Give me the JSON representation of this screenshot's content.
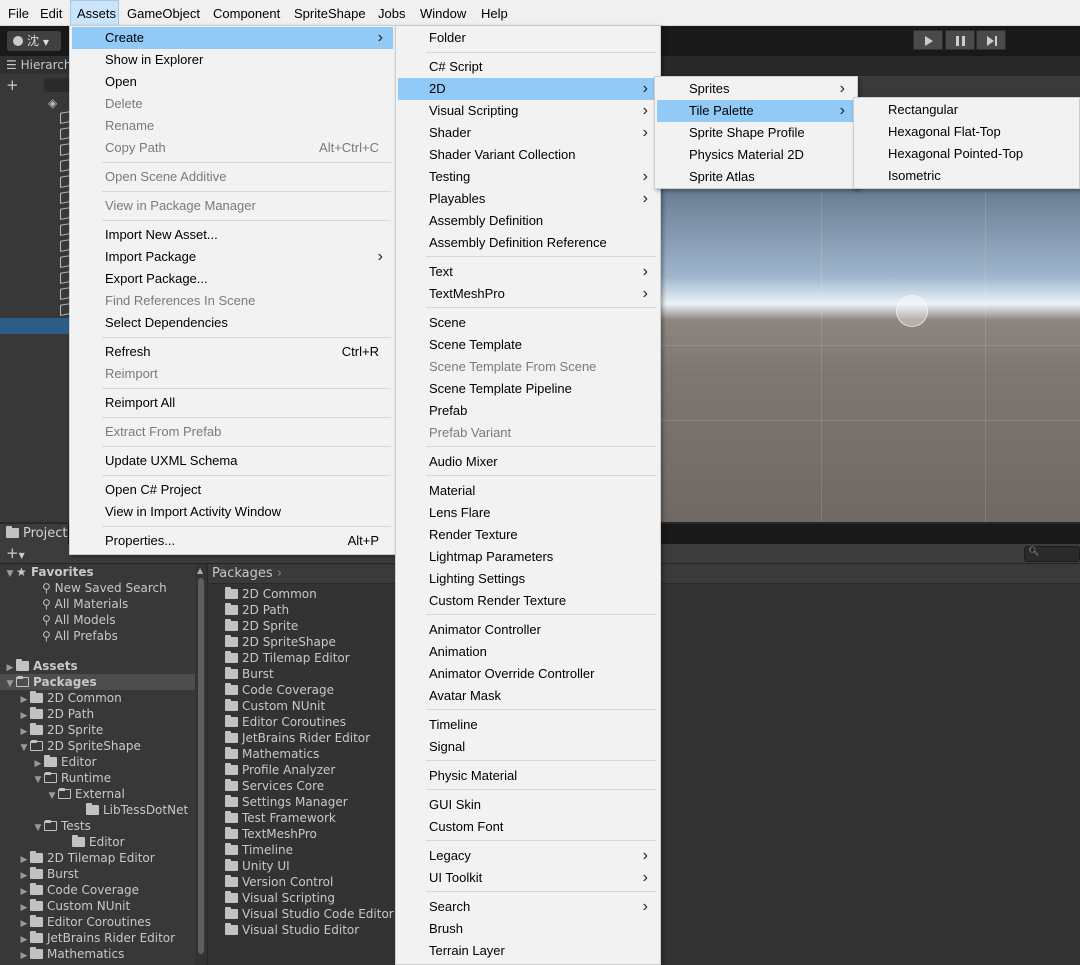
{
  "menubar": {
    "items": [
      "File",
      "Edit",
      "Assets",
      "GameObject",
      "Component",
      "SpriteShape",
      "Jobs",
      "Window",
      "Help"
    ],
    "open_item": "Assets"
  },
  "toolbar": {
    "account": "沈"
  },
  "hierarchy": {
    "tab": "Hierarch",
    "add_label": "+"
  },
  "project": {
    "tab": "Project",
    "breadcrumb": "Packages",
    "tree": [
      {
        "label": "Favorites",
        "bold": true
      },
      {
        "label": "New Saved Search"
      },
      {
        "label": "All Materials"
      },
      {
        "label": "All Models"
      },
      {
        "label": "All Prefabs"
      },
      {
        "label": "Assets",
        "bold": true
      },
      {
        "label": "Packages",
        "bold": true
      },
      {
        "label": "2D Common"
      },
      {
        "label": "2D Path"
      },
      {
        "label": "2D Sprite"
      },
      {
        "label": "2D SpriteShape"
      },
      {
        "label": "Editor"
      },
      {
        "label": "Runtime"
      },
      {
        "label": "External"
      },
      {
        "label": "LibTessDotNet"
      },
      {
        "label": "Tests"
      },
      {
        "label": "Editor"
      },
      {
        "label": "2D Tilemap Editor"
      },
      {
        "label": "Burst"
      },
      {
        "label": "Code Coverage"
      },
      {
        "label": "Custom NUnit"
      },
      {
        "label": "Editor Coroutines"
      },
      {
        "label": "JetBrains Rider Editor"
      },
      {
        "label": "Mathematics"
      }
    ],
    "packages": [
      "2D Common",
      "2D Path",
      "2D Sprite",
      "2D SpriteShape",
      "2D Tilemap Editor",
      "Burst",
      "Code Coverage",
      "Custom NUnit",
      "Editor Coroutines",
      "JetBrains Rider Editor",
      "Mathematics",
      "Profile Analyzer",
      "Services Core",
      "Settings Manager",
      "Test Framework",
      "TextMeshPro",
      "Timeline",
      "Unity UI",
      "Version Control",
      "Visual Scripting",
      "Visual Studio Code Editor",
      "Visual Studio Editor"
    ]
  },
  "assets_menu": {
    "items": [
      {
        "label": "Create",
        "submenu": true,
        "highlight": true
      },
      {
        "label": "Show in Explorer"
      },
      {
        "label": "Open"
      },
      {
        "label": "Delete",
        "disabled": true
      },
      {
        "label": "Rename",
        "disabled": true
      },
      {
        "label": "Copy Path",
        "disabled": true,
        "shortcut": "Alt+Ctrl+C"
      },
      {
        "label": "Open Scene Additive",
        "disabled": true
      },
      {
        "label": "View in Package Manager",
        "disabled": true
      },
      {
        "label": "Import New Asset..."
      },
      {
        "label": "Import Package",
        "submenu": true
      },
      {
        "label": "Export Package..."
      },
      {
        "label": "Find References In Scene",
        "disabled": true
      },
      {
        "label": "Select Dependencies"
      },
      {
        "label": "Refresh",
        "shortcut": "Ctrl+R"
      },
      {
        "label": "Reimport",
        "disabled": true
      },
      {
        "label": "Reimport All"
      },
      {
        "label": "Extract From Prefab",
        "disabled": true
      },
      {
        "label": "Update UXML Schema"
      },
      {
        "label": "Open C# Project"
      },
      {
        "label": "View in Import Activity Window"
      },
      {
        "label": "Properties...",
        "shortcut": "Alt+P"
      }
    ]
  },
  "create_menu": {
    "items": [
      {
        "label": "Folder"
      },
      {
        "label": "C# Script"
      },
      {
        "label": "2D",
        "submenu": true,
        "highlight": true
      },
      {
        "label": "Visual Scripting",
        "submenu": true
      },
      {
        "label": "Shader",
        "submenu": true
      },
      {
        "label": "Shader Variant Collection"
      },
      {
        "label": "Testing",
        "submenu": true
      },
      {
        "label": "Playables",
        "submenu": true
      },
      {
        "label": "Assembly Definition"
      },
      {
        "label": "Assembly Definition Reference"
      },
      {
        "label": "Text",
        "submenu": true
      },
      {
        "label": "TextMeshPro",
        "submenu": true
      },
      {
        "label": "Scene"
      },
      {
        "label": "Scene Template"
      },
      {
        "label": "Scene Template From Scene",
        "disabled": true
      },
      {
        "label": "Scene Template Pipeline"
      },
      {
        "label": "Prefab"
      },
      {
        "label": "Prefab Variant",
        "disabled": true
      },
      {
        "label": "Audio Mixer"
      },
      {
        "label": "Material"
      },
      {
        "label": "Lens Flare"
      },
      {
        "label": "Render Texture"
      },
      {
        "label": "Lightmap Parameters"
      },
      {
        "label": "Lighting Settings"
      },
      {
        "label": "Custom Render Texture"
      },
      {
        "label": "Animator Controller"
      },
      {
        "label": "Animation"
      },
      {
        "label": "Animator Override Controller"
      },
      {
        "label": "Avatar Mask"
      },
      {
        "label": "Timeline"
      },
      {
        "label": "Signal"
      },
      {
        "label": "Physic Material"
      },
      {
        "label": "GUI Skin"
      },
      {
        "label": "Custom Font"
      },
      {
        "label": "Legacy",
        "submenu": true
      },
      {
        "label": "UI Toolkit",
        "submenu": true
      },
      {
        "label": "Search",
        "submenu": true
      },
      {
        "label": "Brush"
      },
      {
        "label": "Terrain Layer"
      }
    ]
  },
  "menu_2d": {
    "items": [
      {
        "label": "Sprites",
        "submenu": true
      },
      {
        "label": "Tile Palette",
        "submenu": true,
        "highlight": true
      },
      {
        "label": "Sprite Shape Profile"
      },
      {
        "label": "Physics Material 2D"
      },
      {
        "label": "Sprite Atlas"
      }
    ]
  },
  "tile_palette_menu": {
    "items": [
      {
        "label": "Rectangular"
      },
      {
        "label": "Hexagonal Flat-Top"
      },
      {
        "label": "Hexagonal Pointed-Top"
      },
      {
        "label": "Isometric"
      }
    ]
  }
}
